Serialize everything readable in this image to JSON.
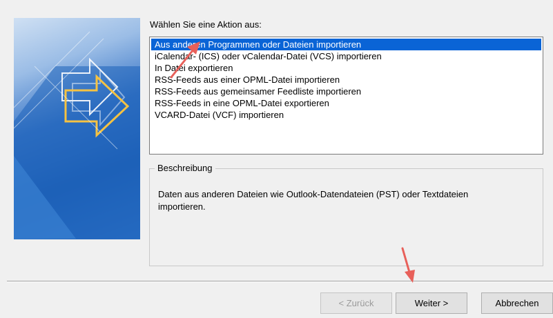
{
  "prompt_label": "Wählen Sie eine Aktion aus:",
  "actions": [
    {
      "label": "Aus anderen Programmen oder Dateien importieren",
      "selected": true
    },
    {
      "label": "iCalendar- (ICS) oder vCalendar-Datei (VCS) importieren",
      "selected": false
    },
    {
      "label": "In Datei exportieren",
      "selected": false
    },
    {
      "label": "RSS-Feeds aus einer OPML-Datei importieren",
      "selected": false
    },
    {
      "label": "RSS-Feeds aus gemeinsamer Feedliste importieren",
      "selected": false
    },
    {
      "label": "RSS-Feeds in eine OPML-Datei exportieren",
      "selected": false
    },
    {
      "label": "VCARD-Datei (VCF) importieren",
      "selected": false
    }
  ],
  "description": {
    "title": "Beschreibung",
    "text": "Daten aus anderen Dateien wie Outlook-Datendateien (PST) oder Textdateien importieren."
  },
  "buttons": {
    "back": "< Zurück",
    "next": "Weiter >",
    "cancel": "Abbrechen"
  },
  "colors": {
    "selection": "#0a64d6",
    "annotation_arrow": "#e8605a"
  }
}
